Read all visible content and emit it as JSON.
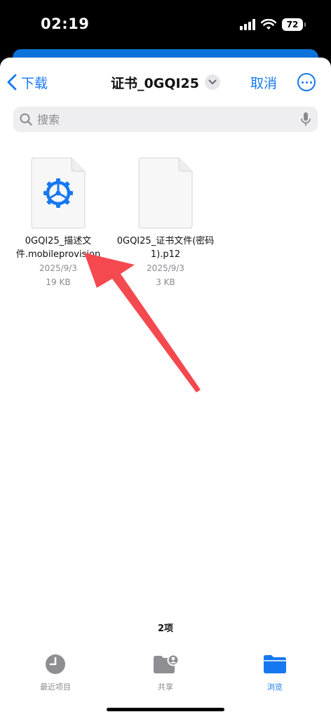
{
  "status_bar": {
    "time": "02:19",
    "battery": "72"
  },
  "nav": {
    "back_label": "下载",
    "title": "证书_0GQI25",
    "cancel_label": "取消"
  },
  "search": {
    "placeholder": "搜索"
  },
  "files": [
    {
      "name": "0GQI25_描述文件.mobileprovision",
      "date": "2025/9/3",
      "size": "19 KB",
      "icon": "settings-gear-icon"
    },
    {
      "name": "0GQI25_证书文件(密码1).p12",
      "date": "2025/9/3",
      "size": "3 KB",
      "icon": "blank-document-icon"
    }
  ],
  "item_count": "2项",
  "tabs": [
    {
      "label": "最近项目",
      "icon": "clock-icon"
    },
    {
      "label": "共享",
      "icon": "shared-folder-icon"
    },
    {
      "label": "浏览",
      "icon": "folder-icon",
      "active": true
    }
  ],
  "colors": {
    "accent": "#1678f0",
    "arrow": "#f4494f",
    "sheet_header": "#0a72d8"
  }
}
